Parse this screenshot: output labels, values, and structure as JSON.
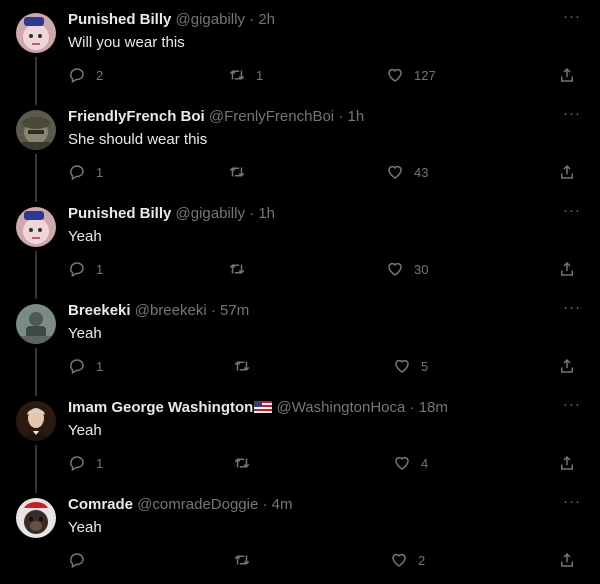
{
  "tweets": [
    {
      "name": "Punished Billy",
      "handle": "@gigabilly",
      "dot": "·",
      "time": "2h",
      "text": "Will you wear this",
      "reply_count": "2",
      "retweet_count": "1",
      "like_count": "127",
      "avatar": "pink-avatar-icon"
    },
    {
      "name": "FriendlyFrench Boi",
      "handle": "@FrenlyFrenchBoi",
      "dot": "·",
      "time": "1h",
      "text": "She should wear this",
      "reply_count": "1",
      "retweet_count": "",
      "like_count": "43",
      "avatar": "soldier-avatar-icon"
    },
    {
      "name": "Punished Billy",
      "handle": "@gigabilly",
      "dot": "·",
      "time": "1h",
      "text": "Yeah",
      "reply_count": "1",
      "retweet_count": "",
      "like_count": "30",
      "avatar": "pink-avatar-icon"
    },
    {
      "name": "Breekeki",
      "handle": "@breekeki",
      "dot": "·",
      "time": "57m",
      "text": "Yeah",
      "reply_count": "1",
      "retweet_count": "",
      "like_count": "5",
      "avatar": "statue-avatar-icon"
    },
    {
      "name": "Imam George Washington",
      "handle": "@WashingtonHoca",
      "dot": "·",
      "time": "18m",
      "text": "Yeah",
      "reply_count": "1",
      "retweet_count": "",
      "like_count": "4",
      "avatar": "portrait-avatar-icon",
      "flag": "us-flag-icon"
    },
    {
      "name": "Comrade",
      "handle": "@comradeDoggie",
      "dot": "·",
      "time": "4m",
      "text": "Yeah",
      "reply_count": "",
      "retweet_count": "",
      "like_count": "2",
      "avatar": "dog-avatar-icon"
    }
  ],
  "icons": {
    "more": "more-icon",
    "reply": "reply-icon",
    "retweet": "retweet-icon",
    "like": "like-icon",
    "share": "share-icon"
  },
  "colors": {
    "background": "#000000",
    "text": "#e7e9ea",
    "muted": "#71767b",
    "connector": "#333639"
  }
}
